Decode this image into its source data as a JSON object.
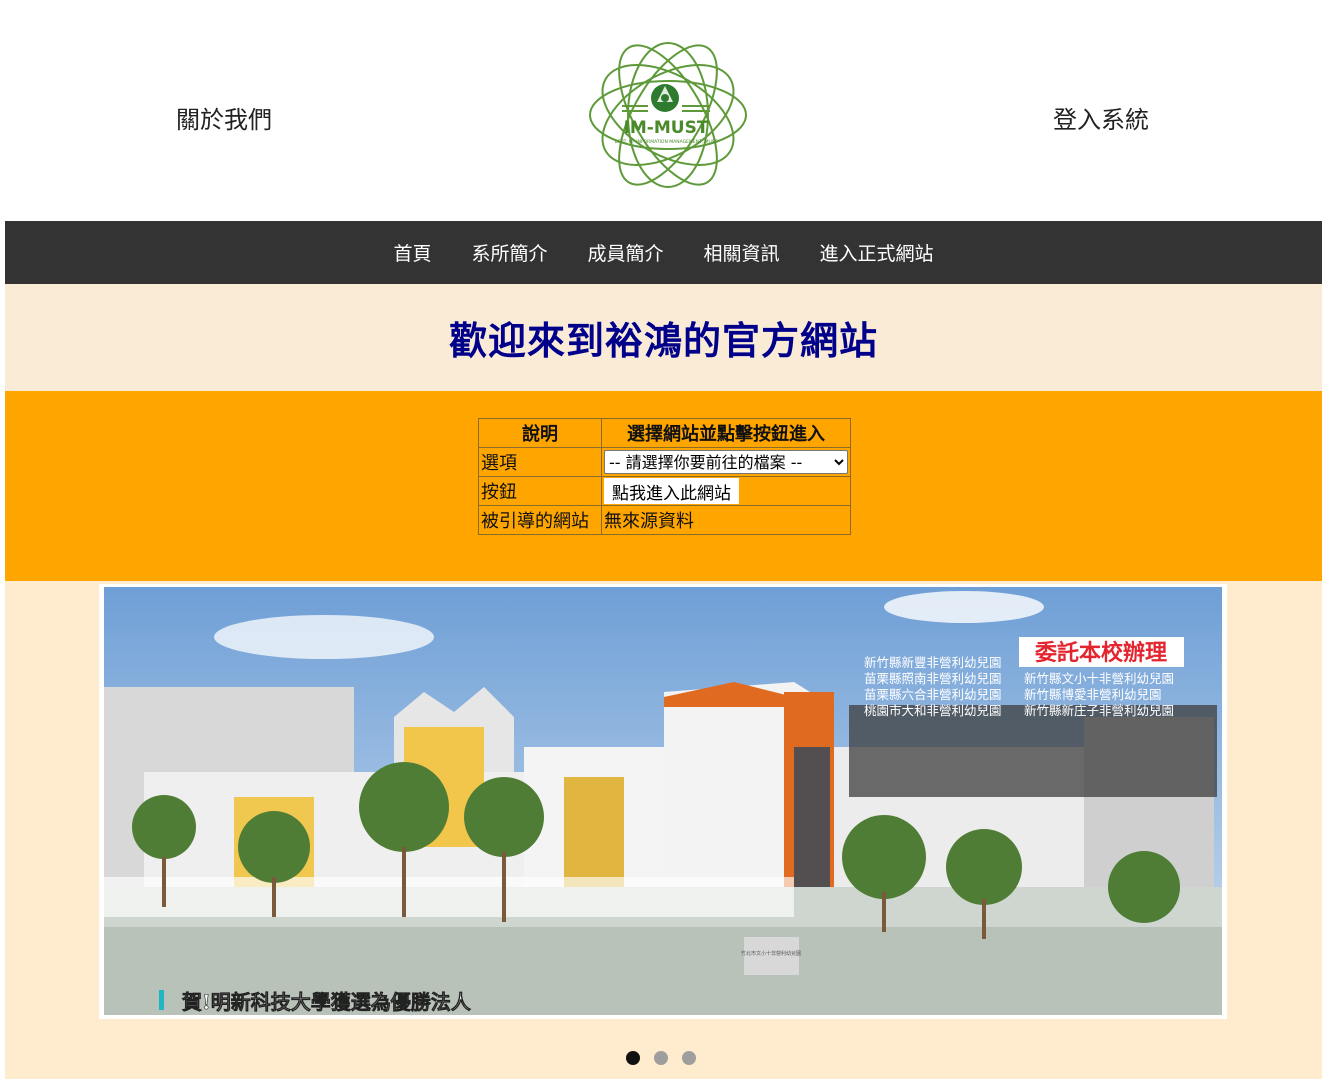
{
  "header": {
    "about_link": "關於我們",
    "login_link": "登入系統",
    "logo": {
      "name": "IM-MUST",
      "subtext": "DEPT. OF INFORMATION MANAGEMENT, MUST"
    }
  },
  "nav": {
    "items": [
      "首頁",
      "系所簡介",
      "成員簡介",
      "相關資訊",
      "進入正式網站"
    ]
  },
  "welcome": {
    "title": "歡迎來到裕鴻的官方網站"
  },
  "table": {
    "headers": [
      "說明",
      "選擇網站並點擊按鈕進入"
    ],
    "rows": [
      {
        "label": "選項"
      },
      {
        "label": "按鈕"
      },
      {
        "label": "被引導的網站",
        "value": "無來源資料"
      }
    ],
    "select_value": "-- 請選擇你要前往的檔案 --",
    "button_label": "點我進入此網站"
  },
  "slider": {
    "banner_title": "委託本校辦理",
    "list_left": [
      "新竹縣新豐非營利幼兒園",
      "苗栗縣照南非營利幼兒園",
      "苗栗縣六合非營利幼兒園",
      "桃園市大和非營利幼兒園"
    ],
    "list_right": [
      "新竹縣文小十非營利幼兒園",
      "新竹縣博愛非營利幼兒園",
      "新竹縣新庄子非營利幼兒園"
    ],
    "caption": "賀!明新科技大學獲選為優勝法人",
    "building_sign": "竹北市文小十非營利幼兒園",
    "dot_count": 3,
    "active_dot": 0
  },
  "colors": {
    "navbar": "#333333",
    "welcome_bg": "#faebd7",
    "title": "#00008b",
    "orange": "#ffa500",
    "slider_bg": "#ffebcd",
    "logo_green": "#4a8a2a"
  }
}
